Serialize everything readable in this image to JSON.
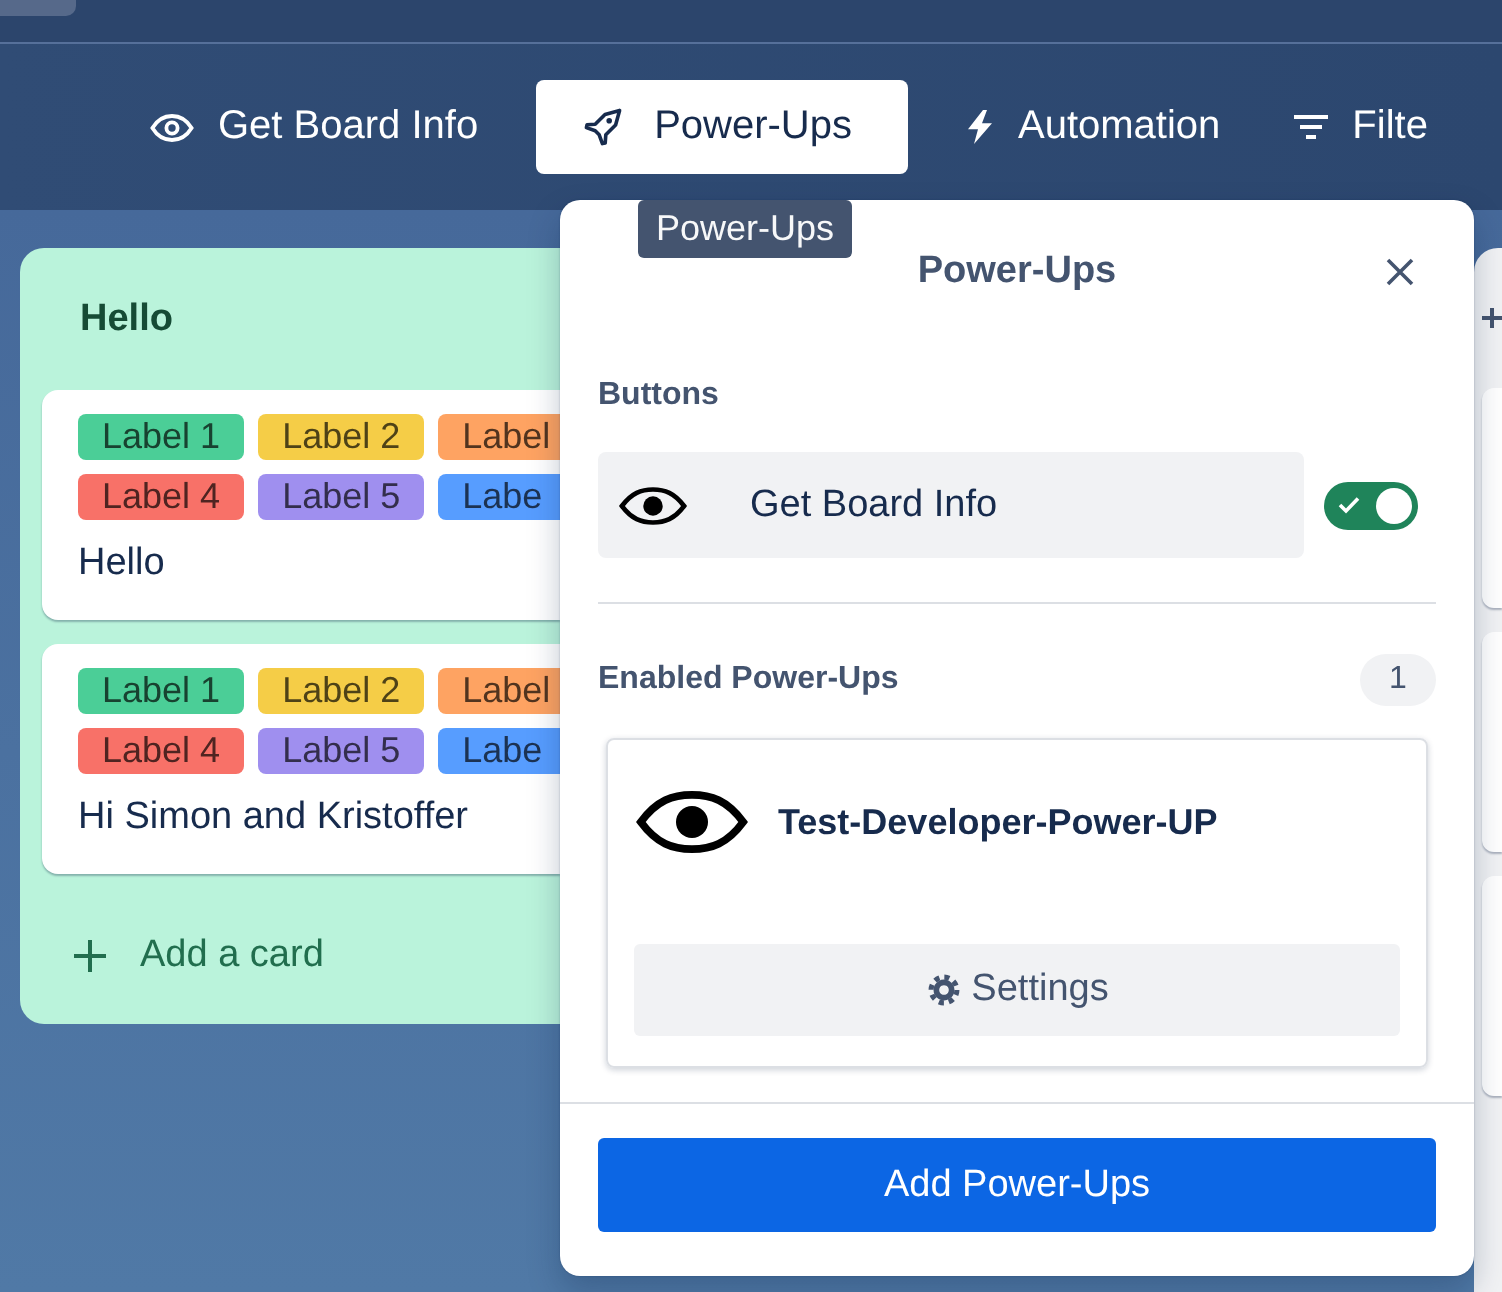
{
  "board_header": {
    "buttons": [
      {
        "kind": "eye",
        "label": "Get Board Info",
        "selected": false
      },
      {
        "kind": "rocket",
        "label": "Power-Ups",
        "selected": true
      },
      {
        "kind": "bolt",
        "label": "Automation",
        "selected": false
      },
      {
        "kind": "filter",
        "label": "Filte",
        "selected": false
      }
    ]
  },
  "lists": [
    {
      "title": "Hello",
      "cards": [
        {
          "labels": [
            {
              "text": "Label 1",
              "color": "#4bce97"
            },
            {
              "text": "Label 2",
              "color": "#f5cd47"
            },
            {
              "text": "Label",
              "color": "#fea362"
            },
            {
              "text": "Label 4",
              "color": "#f87168"
            },
            {
              "text": "Label 5",
              "color": "#9f8fef"
            },
            {
              "text": "Labe",
              "color": "#579dff"
            }
          ],
          "title": "Hello"
        },
        {
          "labels": [
            {
              "text": "Label 1",
              "color": "#4bce97"
            },
            {
              "text": "Label 2",
              "color": "#f5cd47"
            },
            {
              "text": "Label",
              "color": "#fea362"
            },
            {
              "text": "Label 4",
              "color": "#f87168"
            },
            {
              "text": "Label 5",
              "color": "#9f8fef"
            },
            {
              "text": "Labe",
              "color": "#579dff"
            }
          ],
          "title": "Hi Simon and Kristoffer"
        }
      ],
      "add_card": "Add a card"
    }
  ],
  "tooltip": {
    "text": "Power-Ups"
  },
  "popup": {
    "title": "Power-Ups",
    "buttons_section": {
      "heading": "Buttons",
      "items": [
        {
          "label": "Get Board Info",
          "on": true
        }
      ]
    },
    "enabled_section": {
      "heading": "Enabled Power-Ups",
      "count": "1",
      "items": [
        {
          "name": "Test-Developer-Power-UP",
          "action": "Settings"
        }
      ]
    },
    "add_button": "Add Power-Ups"
  }
}
